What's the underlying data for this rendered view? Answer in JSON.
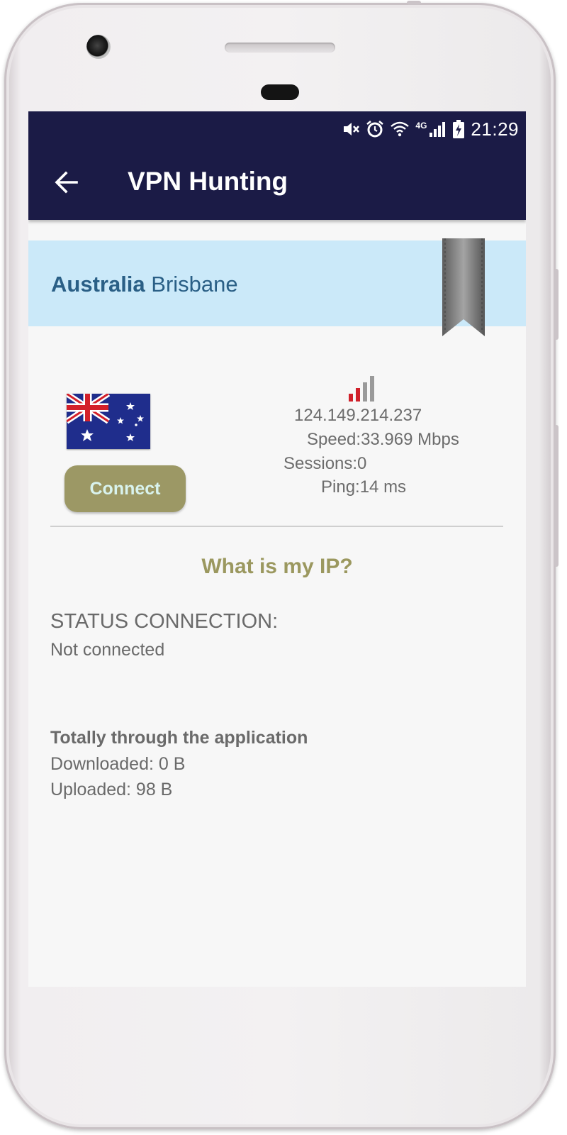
{
  "status_bar": {
    "time": "21:29",
    "network": "4G",
    "icons": [
      "mute-icon",
      "alarm-icon",
      "wifi-icon",
      "cell-signal-icon",
      "battery-charging-icon"
    ]
  },
  "app_bar": {
    "title": "VPN Hunting",
    "back_icon": "arrow-left-icon"
  },
  "server": {
    "country": "Australia",
    "city": "Brisbane",
    "flag": "australia-flag",
    "ip": "124.149.214.237",
    "speed": "Speed:33.969 Mbps",
    "sessions": "Sessions:0",
    "ping": "Ping:14 ms",
    "signal_strength": 2,
    "signal_max": 4
  },
  "connect_button": {
    "label": "Connect"
  },
  "my_ip_link": "What is my IP?",
  "status": {
    "label": "STATUS CONNECTION:",
    "value": "Not connected"
  },
  "traffic": {
    "label": "Totally through the application",
    "downloaded": "Downloaded: 0 B",
    "uploaded": "Uploaded: 98 B"
  },
  "colors": {
    "app_bar": "#1b1b46",
    "banner": "#cbe9f9",
    "accent": "#9c9865",
    "signal_active": "#d0202a",
    "signal_inactive": "#9a9a9a"
  }
}
